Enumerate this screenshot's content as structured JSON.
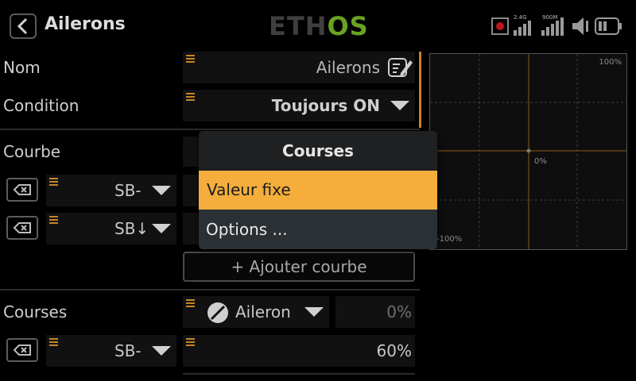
{
  "header": {
    "title": "Ailerons",
    "logo_left": "ETH",
    "logo_right": "OS",
    "rf_label_1": "2.4G",
    "rf_label_2": "900M"
  },
  "form": {
    "name_label": "Nom",
    "name_value": "Ailerons",
    "condition_label": "Condition",
    "condition_value": "Toujours ON",
    "curve_label": "Courbe",
    "curve_rows": [
      {
        "switch": "SB-"
      },
      {
        "switch": "SB↓"
      }
    ],
    "add_curve_label": "+ Ajouter courbe",
    "rates_label": "Courses",
    "rates_source": "Aileron",
    "rates_value": "0%",
    "rates_row_switch": "SB-",
    "rates_row_value": "60%"
  },
  "graph": {
    "top_label": "100%",
    "mid_label": "0%",
    "bottom_label": "-100%"
  },
  "popup": {
    "title": "Courses",
    "items": [
      "Valeur fixe",
      "Options ..."
    ]
  },
  "colors": {
    "accent": "#f5ae3b",
    "grip": "#c7832b",
    "logo_green": "#6aa123",
    "record_red": "#c0141f"
  },
  "icons": {
    "back": "chevron-left-icon",
    "edit": "edit-icon",
    "delete": "backspace-icon",
    "source": "source-slash-icon",
    "battery": "battery-icon",
    "volume": "speaker-icon"
  }
}
